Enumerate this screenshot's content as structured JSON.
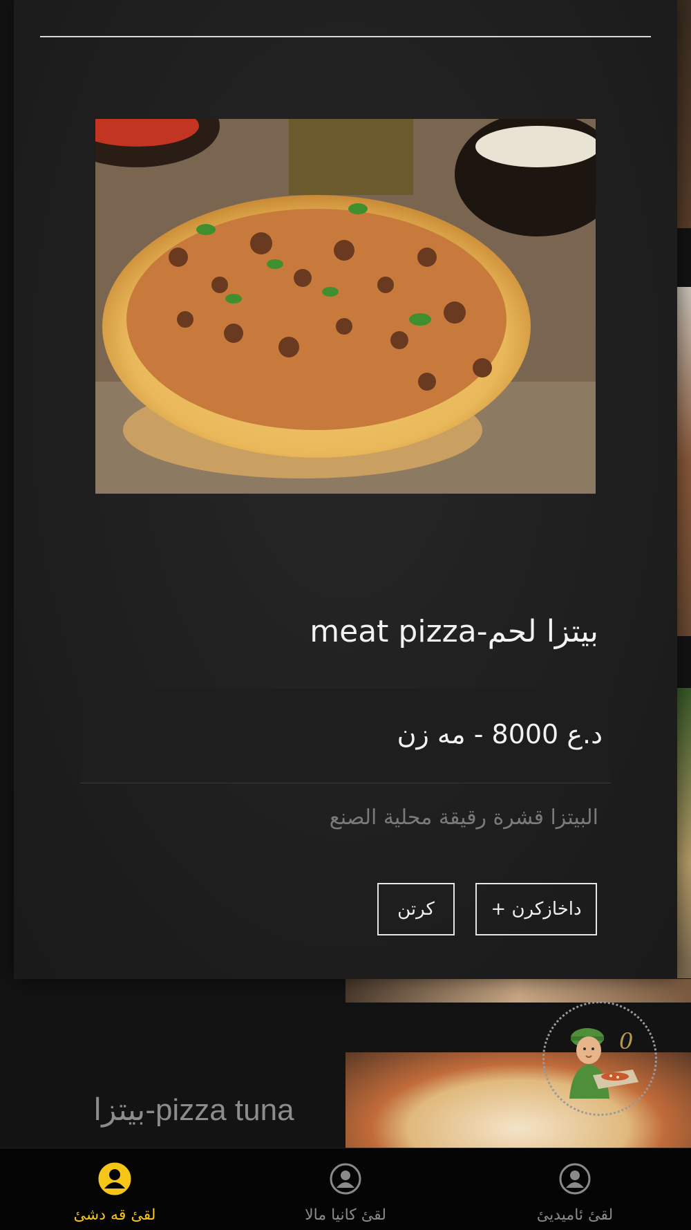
{
  "modal": {
    "product_name": "بيتزا لحم-meat pizza",
    "price": "د.ع 8000 - مه زن",
    "description": "البيتزا قشرة رقيقة محلية الصنع",
    "add_label": "داخازكرن +",
    "cancel_label": "كرتن",
    "image_icon": "pizza-photo"
  },
  "background": {
    "item_title": "بيتزا-pizza tuna"
  },
  "cart": {
    "count": "0",
    "icon": "delivery-courier"
  },
  "nav": {
    "items": [
      {
        "label": "لقىٔ قه دشىٔ",
        "icon": "user-circle-icon",
        "active": true
      },
      {
        "label": "لقىٔ كانيا مالا",
        "icon": "user-circle-icon",
        "active": false
      },
      {
        "label": "لقىٔ ئاميديىٔ",
        "icon": "user-circle-icon",
        "active": false
      }
    ]
  },
  "colors": {
    "accent": "#f5c518",
    "inactive": "#8a8a8a",
    "modal_bg": "#1f1f1f"
  }
}
